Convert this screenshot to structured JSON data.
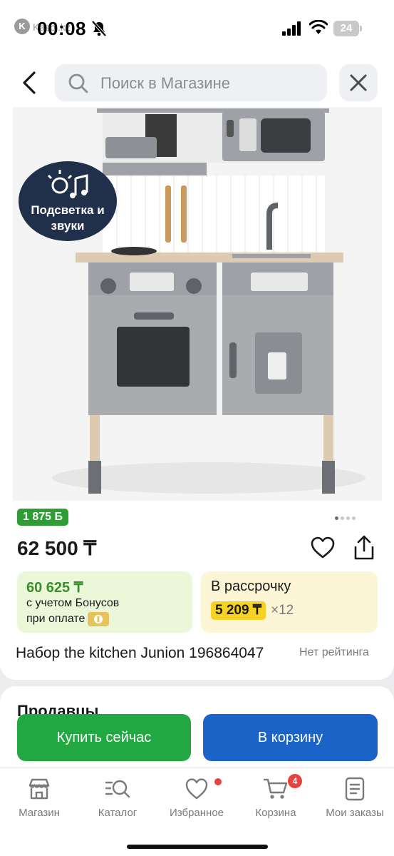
{
  "status_bar": {
    "time": "00:08",
    "carrier_app": "Kaspi.kz",
    "battery": "24"
  },
  "search": {
    "placeholder": "Поиск в Магазине"
  },
  "product": {
    "promo_badge": "Подсветка и звуки",
    "bonus_badge": "1 875 Б",
    "price": "62 500 ₸",
    "image_pages": 4,
    "image_active_index": 0,
    "bonus_price": "60 625 ₸",
    "bonus_line1": "с учетом Бонусов",
    "bonus_line2": "при оплате",
    "installment_title": "В рассрочку",
    "installment_amount": "5 209 ₸",
    "installment_multiplier": "×12",
    "title": "Набор the kitchen Junion 196864047",
    "rating_text": "Нет рейтинга"
  },
  "sellers_heading": "Продавцы",
  "actions": {
    "buy_now": "Купить сейчас",
    "add_to_cart": "В корзину"
  },
  "tabbar": {
    "items": [
      {
        "label": "Магазин",
        "icon": "store-icon"
      },
      {
        "label": "Каталог",
        "icon": "catalog-search-icon"
      },
      {
        "label": "Избранное",
        "icon": "heart-icon",
        "has_dot": true
      },
      {
        "label": "Корзина",
        "icon": "cart-icon",
        "badge": "4"
      },
      {
        "label": "Мои заказы",
        "icon": "orders-icon"
      }
    ]
  },
  "colors": {
    "buy_green": "#22a843",
    "cart_blue": "#1b63c6",
    "bonus_green": "#2e9e34",
    "installment_yellow": "#f5d223",
    "notification_red": "#e8423f"
  }
}
